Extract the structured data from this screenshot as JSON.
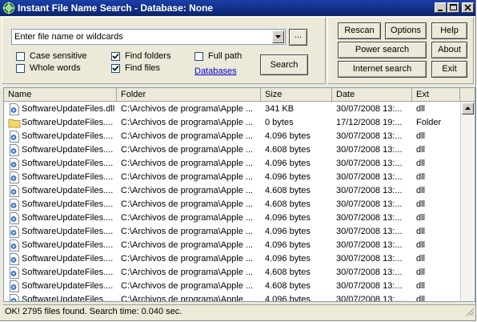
{
  "window": {
    "title": "Instant File Name Search - Database: None"
  },
  "search": {
    "placeholder": "Enter file name or wildcards",
    "browse_label": "...",
    "search_label": "Search"
  },
  "options": [
    {
      "label": "Case sensitive",
      "checked": false
    },
    {
      "label": "Whole words",
      "checked": false
    },
    {
      "label": "Find folders",
      "checked": true
    },
    {
      "label": "Find files",
      "checked": true
    },
    {
      "label": "Full path",
      "checked": false
    }
  ],
  "databases_link": "Databases",
  "buttons": {
    "rescan": "Rescan",
    "options": "Options",
    "help": "Help",
    "power_search": "Power search",
    "about": "About",
    "internet_search": "Internet search",
    "exit": "Exit"
  },
  "columns": [
    "Name",
    "Folder",
    "Size",
    "Date",
    "Ext"
  ],
  "rows": [
    {
      "name": "SoftwareUpdateFiles.dll",
      "folder": "C:\\Archivos de programa\\Apple ...",
      "size": "341 KB",
      "date": "30/07/2008 13:...",
      "ext": "dll",
      "icon": "dll-file-icon"
    },
    {
      "name": "SoftwareUpdateFiles....",
      "folder": "C:\\Archivos de programa\\Apple ...",
      "size": "0 bytes",
      "date": "17/12/2008 19:...",
      "ext": "Folder",
      "icon": "folder-icon"
    },
    {
      "name": "SoftwareUpdateFiles....",
      "folder": "C:\\Archivos de programa\\Apple ...",
      "size": "4.096 bytes",
      "date": "30/07/2008 13:...",
      "ext": "dll",
      "icon": "dll-file-icon"
    },
    {
      "name": "SoftwareUpdateFiles....",
      "folder": "C:\\Archivos de programa\\Apple ...",
      "size": "4.608 bytes",
      "date": "30/07/2008 13:...",
      "ext": "dll",
      "icon": "dll-file-icon"
    },
    {
      "name": "SoftwareUpdateFiles....",
      "folder": "C:\\Archivos de programa\\Apple ...",
      "size": "4.096 bytes",
      "date": "30/07/2008 13:...",
      "ext": "dll",
      "icon": "dll-file-icon"
    },
    {
      "name": "SoftwareUpdateFiles....",
      "folder": "C:\\Archivos de programa\\Apple ...",
      "size": "4.096 bytes",
      "date": "30/07/2008 13:...",
      "ext": "dll",
      "icon": "dll-file-icon"
    },
    {
      "name": "SoftwareUpdateFiles....",
      "folder": "C:\\Archivos de programa\\Apple ...",
      "size": "4.608 bytes",
      "date": "30/07/2008 13:...",
      "ext": "dll",
      "icon": "dll-file-icon"
    },
    {
      "name": "SoftwareUpdateFiles....",
      "folder": "C:\\Archivos de programa\\Apple ...",
      "size": "4.608 bytes",
      "date": "30/07/2008 13:...",
      "ext": "dll",
      "icon": "dll-file-icon"
    },
    {
      "name": "SoftwareUpdateFiles....",
      "folder": "C:\\Archivos de programa\\Apple ...",
      "size": "4.096 bytes",
      "date": "30/07/2008 13:...",
      "ext": "dll",
      "icon": "dll-file-icon"
    },
    {
      "name": "SoftwareUpdateFiles....",
      "folder": "C:\\Archivos de programa\\Apple ...",
      "size": "4.096 bytes",
      "date": "30/07/2008 13:...",
      "ext": "dll",
      "icon": "dll-file-icon"
    },
    {
      "name": "SoftwareUpdateFiles....",
      "folder": "C:\\Archivos de programa\\Apple ...",
      "size": "4.096 bytes",
      "date": "30/07/2008 13:...",
      "ext": "dll",
      "icon": "dll-file-icon"
    },
    {
      "name": "SoftwareUpdateFiles....",
      "folder": "C:\\Archivos de programa\\Apple ...",
      "size": "4.096 bytes",
      "date": "30/07/2008 13:...",
      "ext": "dll",
      "icon": "dll-file-icon"
    },
    {
      "name": "SoftwareUpdateFiles....",
      "folder": "C:\\Archivos de programa\\Apple ...",
      "size": "4.608 bytes",
      "date": "30/07/2008 13:...",
      "ext": "dll",
      "icon": "dll-file-icon"
    },
    {
      "name": "SoftwareUpdateFiles....",
      "folder": "C:\\Archivos de programa\\Apple ...",
      "size": "4.608 bytes",
      "date": "30/07/2008 13:...",
      "ext": "dll",
      "icon": "dll-file-icon"
    },
    {
      "name": "SoftwareUpdateFiles....",
      "folder": "C:\\Archivos de programa\\Apple ...",
      "size": "4.096 bytes",
      "date": "30/07/2008 13:...",
      "ext": "dll",
      "icon": "dll-file-icon"
    }
  ],
  "status": "OK! 2795 files found. Search time: 0.040 sec."
}
